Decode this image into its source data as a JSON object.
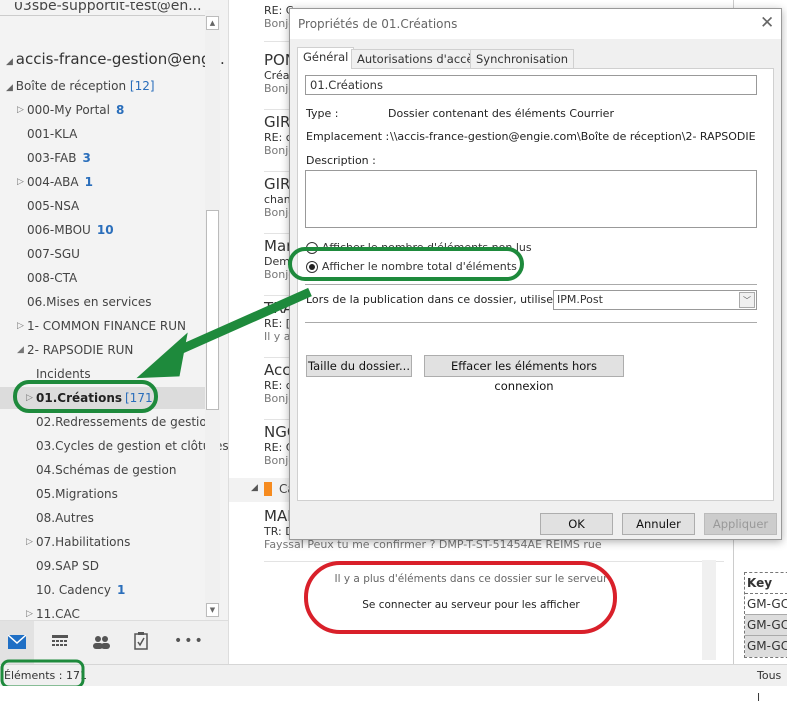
{
  "folders": {
    "prev_account": "03sbe-supportit-test@en...",
    "account": "accis-france-gestion@eng...",
    "inbox": {
      "label": "Boîte de réception",
      "count": "[12]"
    },
    "items": [
      {
        "label": "000-My Portal",
        "count": "8",
        "expand": true,
        "indent": 1
      },
      {
        "label": "001-KLA",
        "count": "",
        "expand": false,
        "indent": 1
      },
      {
        "label": "003-FAB",
        "count": "3",
        "expand": false,
        "indent": 1
      },
      {
        "label": "004-ABA",
        "count": "1",
        "expand": true,
        "indent": 1
      },
      {
        "label": "005-NSA",
        "count": "",
        "expand": false,
        "indent": 1
      },
      {
        "label": "006-MBOU",
        "count": "10",
        "expand": false,
        "indent": 1
      },
      {
        "label": "007-SGU",
        "count": "",
        "expand": false,
        "indent": 1
      },
      {
        "label": "008-CTA",
        "count": "",
        "expand": false,
        "indent": 1
      },
      {
        "label": "06.Mises en services",
        "count": "",
        "expand": false,
        "indent": 1
      },
      {
        "label": "1- COMMON FINANCE RUN",
        "count": "",
        "expand": true,
        "indent": 1
      },
      {
        "label": "2- RAPSODIE RUN",
        "count": "",
        "expand": "open",
        "indent": 1
      },
      {
        "label": "Incidents",
        "count": "",
        "expand": false,
        "indent": 2
      },
      {
        "label": "01.Créations",
        "count": "[171]",
        "expand": true,
        "indent": 2,
        "selected": true
      },
      {
        "label": "02.Redressements de gestion",
        "count": "",
        "expand": false,
        "indent": 2
      },
      {
        "label": "03.Cycles de gestion et clôtures",
        "count": "",
        "expand": false,
        "indent": 2
      },
      {
        "label": "04.Schémas de gestion",
        "count": "",
        "expand": false,
        "indent": 2
      },
      {
        "label": "05.Migrations",
        "count": "",
        "expand": false,
        "indent": 2
      },
      {
        "label": "08.Autres",
        "count": "",
        "expand": false,
        "indent": 2
      },
      {
        "label": "07.Habilitations",
        "count": "",
        "expand": true,
        "indent": 2
      },
      {
        "label": "09.SAP SD",
        "count": "",
        "expand": false,
        "indent": 2
      },
      {
        "label": "10. Cadency",
        "count": "1",
        "expand": false,
        "indent": 2
      },
      {
        "label": "11.CAC",
        "count": "",
        "expand": true,
        "indent": 2
      }
    ]
  },
  "nav": [
    "mail-icon",
    "calendar-icon",
    "people-icon",
    "tasks-icon",
    "more-icon"
  ],
  "messages": [
    {
      "sender": "",
      "subject": "RE: C",
      "preview": "Bonjo"
    },
    {
      "sender": "PON",
      "subject": "Créat",
      "preview": "Bonjo"
    },
    {
      "sender": "GIRA",
      "subject": "RE: cl",
      "preview": "Bonjo"
    },
    {
      "sender": "GIRA",
      "subject": "chan",
      "preview": "Bonjo"
    },
    {
      "sender": "Mar",
      "subject": "Dem",
      "preview": "Bonjo"
    },
    {
      "sender": "TRA",
      "subject": "RE: [C",
      "preview": "Il y a"
    },
    {
      "sender": "Acci",
      "subject": "RE: c",
      "preview": "Bonjo"
    },
    {
      "sender": "NGC",
      "subject": "RE: C",
      "preview": "Bonjo"
    }
  ],
  "group_header": "Ca",
  "last_message": {
    "sender": "MAI",
    "subject": "TR: D",
    "preview": "Fayssal   Peux tu me confirmer ?   DMP-T-ST-51454AE  REIMS rue"
  },
  "server_notice": {
    "line1": "Il y a plus d'éléments dans ce dossier sur le serveur",
    "link": "Se connecter au serveur pour les afficher"
  },
  "status": {
    "items": "Éléments : 171",
    "right": "Tous l"
  },
  "reading": {
    "table_header": "Key",
    "rows": [
      "GM-GC",
      "GM-GC",
      "GM-GC"
    ]
  },
  "dialog": {
    "title": "Propriétés de 01.Créations",
    "tabs": [
      "Général",
      "Autorisations d'accès",
      "Synchronisation"
    ],
    "name_value": "01.Créations",
    "type_label": "Type :",
    "type_value": "Dossier contenant des éléments Courrier",
    "location_label": "Emplacement :",
    "location_value": "\\\\accis-france-gestion@engie.com\\Boîte de réception\\2- RAPSODIE",
    "description_label": "Description :",
    "radio_unread": "Afficher le nombre d'éléments non lus",
    "radio_total": "Afficher le nombre total d'éléments",
    "radio_selected": "total",
    "post_label": "Lors de la publication dans ce dossier, utiliser :",
    "post_value": "IPM.Post",
    "btn_size": "Taille du dossier...",
    "btn_clear": "Effacer les éléments hors connexion",
    "ok": "OK",
    "cancel": "Annuler",
    "apply": "Appliquer"
  },
  "colors": {
    "annotation_green": "#1e8a3c",
    "annotation_red": "#d9202a",
    "accent": "#2a6ebb"
  }
}
